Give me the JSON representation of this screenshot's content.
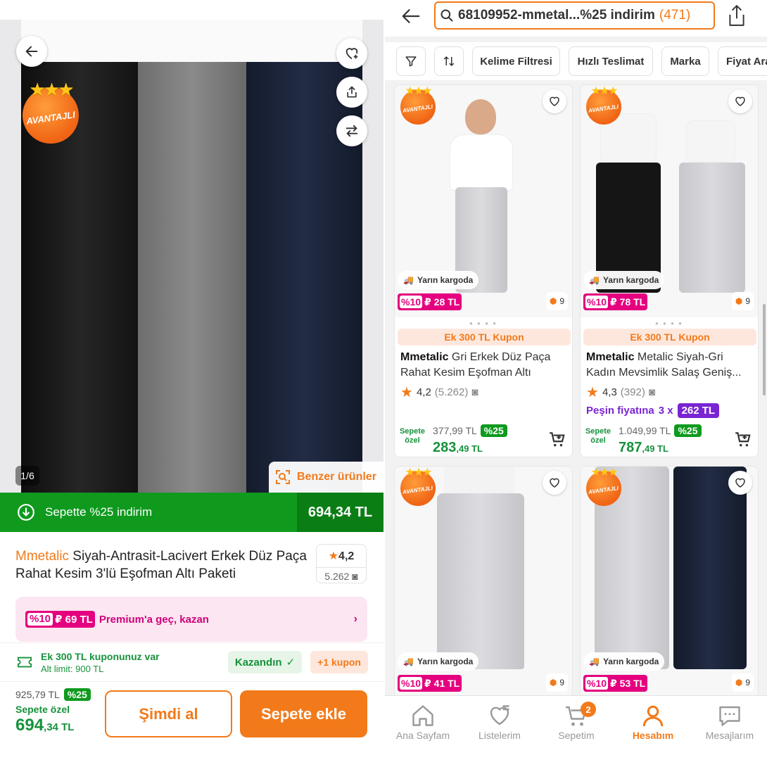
{
  "product_page": {
    "image_counter": "1/6",
    "advantage_badge": "AVANTAJLI",
    "similar_products": "Benzer ürünler",
    "promo": {
      "label": "Sepette %25 indirim",
      "price": "694,34 TL"
    },
    "brand": "Mmetalic",
    "title": "Siyah-Antrasit-Lacivert Erkek Düz Paça Rahat Kesim 3'lü Eşofman Altı Paketi",
    "rating": "4,2",
    "review_count": "5.262",
    "premium": {
      "pct": "%10",
      "amount": "₽ 69 TL",
      "text": "Premium'a geç, kazan"
    },
    "coupon": {
      "line1": "Ek 300 TL kuponunuz var",
      "line2": "Alt limit: 900 TL",
      "won": "Kazandın",
      "plus": "+1 kupon"
    },
    "price": {
      "old": "925,79 TL",
      "pct": "%25",
      "label": "Sepete özel",
      "now_main": "694",
      "now_dec": ",34 TL"
    },
    "buy_now": "Şimdi al",
    "add_to_cart": "Sepete ekle"
  },
  "search_page": {
    "query": "68109952-mmetal...%25 indirim",
    "count": "(471)",
    "filters": [
      "Kelime Filtresi",
      "Hızlı Teslimat",
      "Marka",
      "Fiyat Ara"
    ],
    "products": [
      {
        "cargo": "Yarın kargoda",
        "pct": "%10",
        "amount": "₽ 28 TL",
        "ship": "9",
        "coupon": "Ek 300 TL Kupon",
        "brand": "Mmetalic",
        "name": "Gri Erkek Düz Paça Rahat Kesim Eşofman Altı",
        "name_line1": "Gri Erkek Düz Paça",
        "name_line2": "Rahat Kesim Eşofman Altı",
        "rating": "4,2",
        "reviews": "(5.262)",
        "old": "377,99 TL",
        "discount": "%25",
        "special": "Sepete özel",
        "now_main": "283",
        "now_dec": ",49 TL"
      },
      {
        "cargo": "Yarın kargoda",
        "pct": "%10",
        "amount": "₽ 78 TL",
        "ship": "9",
        "coupon": "Ek 300 TL Kupon",
        "brand": "Mmetalic",
        "name_line1": "Metalic Siyah-Gri",
        "name_line2": "Kadın Mevsimlik Salaş Geniş...",
        "rating": "4,3",
        "reviews": "(392)",
        "installment_label": "Peşin fiyatına",
        "installment_count": "3 x",
        "installment_price": "262 TL",
        "old": "1.049,99 TL",
        "discount": "%25",
        "special": "Sepete özel",
        "now_main": "787",
        "now_dec": ",49 TL"
      },
      {
        "cargo": "Yarın kargoda",
        "pct": "%10",
        "amount": "₽ 41 TL",
        "ship": "9"
      },
      {
        "cargo": "Yarın kargoda",
        "pct": "%10",
        "amount": "₽ 53 TL",
        "ship": "9"
      }
    ],
    "tabs": [
      {
        "label": "Ana Sayfam",
        "icon": "home-icon"
      },
      {
        "label": "Listelerim",
        "icon": "heart-list-icon"
      },
      {
        "label": "Sepetim",
        "icon": "cart-icon",
        "badge": "2"
      },
      {
        "label": "Hesabım",
        "icon": "user-icon",
        "active": true
      },
      {
        "label": "Mesajlarım",
        "icon": "message-icon"
      }
    ]
  },
  "colors": {
    "accent": "#f27a1a",
    "green": "#0f9a1e",
    "pink": "#e4007e",
    "purple": "#7a25d3"
  }
}
